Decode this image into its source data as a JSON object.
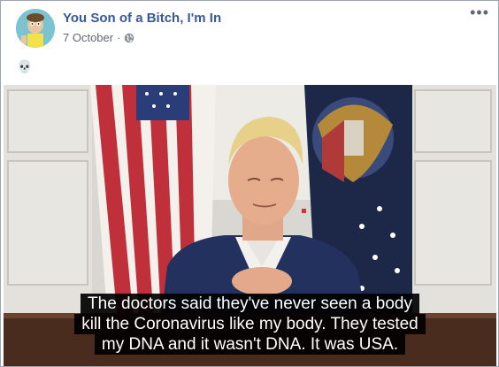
{
  "post": {
    "author": "You Son of a Bitch, I'm In",
    "date": "7 October",
    "separator": "·",
    "privacy_icon": "globe-icon",
    "more_label": "•••",
    "text": "💀"
  },
  "media": {
    "caption_lines": [
      "The doctors said they've never seen a body",
      "kill the Coronavirus like my body. They tested",
      "my DNA and it wasn't DNA. It was USA."
    ]
  },
  "colors": {
    "author": "#385898",
    "meta": "#616770",
    "border": "#9aa4b5"
  }
}
